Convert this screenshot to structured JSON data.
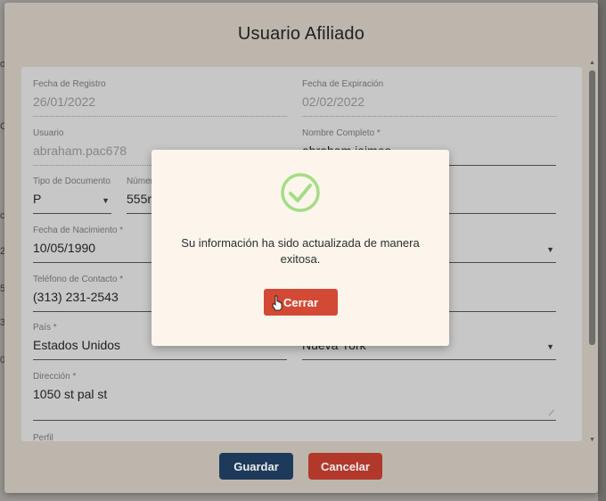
{
  "dialog": {
    "title": "Usuario Afiliado"
  },
  "form": {
    "fecha_registro": {
      "label": "Fecha de Registro",
      "value": "26/01/2022"
    },
    "fecha_expiracion": {
      "label": "Fecha de Expiración",
      "value": "02/02/2022"
    },
    "usuario": {
      "label": "Usuario",
      "value": "abraham.pac678"
    },
    "nombre_completo": {
      "label": "Nombre Completo *",
      "value": "abraham jaimes"
    },
    "tipo_documento": {
      "label": "Tipo de Documento...",
      "value": "P"
    },
    "numero_documento": {
      "label": "Númer",
      "value": "555r"
    },
    "fecha_nacimiento": {
      "label": "Fecha de Nacimiento *",
      "value": "10/05/1990"
    },
    "telefono": {
      "label": "Teléfono de Contacto *",
      "value": "(313) 231-2543"
    },
    "pais": {
      "label": "País *",
      "value": "Estados Unidos"
    },
    "estado": {
      "value": "Nueva York"
    },
    "direccion": {
      "label": "Dirección *",
      "value": "1050 st pal st"
    },
    "perfil": {
      "label": "Perfil"
    }
  },
  "footer": {
    "guardar_label": "Guardar",
    "cancelar_label": "Cancelar"
  },
  "alert": {
    "icon": "success-check-icon",
    "message": "Su información ha sido actualizada de manera exitosa.",
    "close_label": "Cerrar"
  },
  "colors": {
    "overlay_dialog": "#bcb6ad",
    "guardar": "#1d3a5a",
    "cancelar": "#b2382b",
    "cerrar": "#d24a36",
    "success": "#a5dc86"
  }
}
